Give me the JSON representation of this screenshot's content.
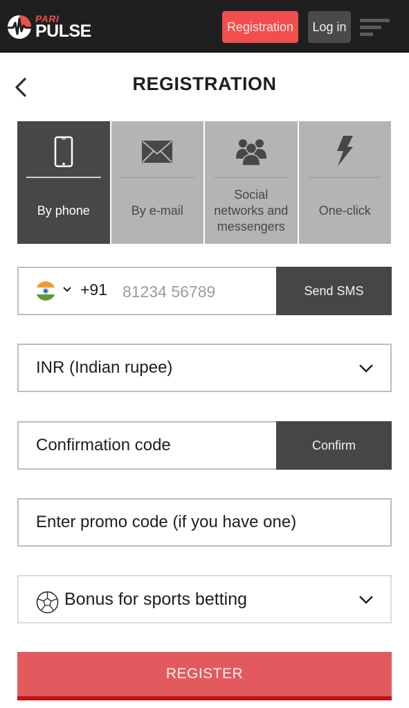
{
  "header": {
    "logo": {
      "top_text": "PARI",
      "main_text": "PULSE"
    },
    "registration_button": "Registration",
    "login_button": "Log in",
    "menu_icon": "hamburger-menu-icon"
  },
  "page": {
    "title": "REGISTRATION",
    "back_icon": "chevron-left-icon"
  },
  "tabs": [
    {
      "label": "By phone",
      "icon": "smartphone-icon",
      "active": true
    },
    {
      "label": "By e-mail",
      "icon": "envelope-icon",
      "active": false
    },
    {
      "label": "Social networks and messengers",
      "icon": "users-group-icon",
      "active": false
    },
    {
      "label": "One-click",
      "icon": "lightning-bolt-icon",
      "active": false
    }
  ],
  "form": {
    "phone": {
      "country_flag": "india-flag-icon",
      "dial_code": "+91",
      "placeholder": "81234 56789",
      "value": "",
      "send_button": "Send SMS"
    },
    "currency": {
      "selected": "INR (Indian rupee)"
    },
    "confirmation": {
      "placeholder": "Confirmation code",
      "value": "",
      "confirm_button": "Confirm"
    },
    "promo": {
      "placeholder": "Enter promo code (if you have one)",
      "value": ""
    },
    "bonus": {
      "icon": "soccer-ball-icon",
      "selected": "Bonus for sports betting"
    },
    "register_button": "REGISTER"
  },
  "colors": {
    "header_bg": "#1f1f1f",
    "accent_red": "#f24e4e",
    "register_bg": "#e35a5e",
    "register_border": "#c01318",
    "dark_button": "#464646",
    "tab_inactive": "#b4b4b4"
  }
}
